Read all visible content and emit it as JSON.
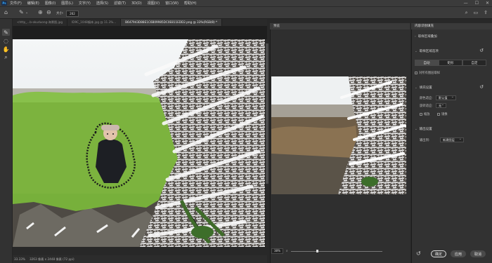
{
  "menubar": {
    "logo": "Ps",
    "items": [
      "文件(F)",
      "编辑(E)",
      "图像(I)",
      "图层(L)",
      "文字(Y)",
      "选择(S)",
      "滤镜(T)",
      "3D(D)",
      "视图(V)",
      "窗口(W)",
      "帮助(H)"
    ],
    "window_controls": [
      "—",
      "☐",
      "✕"
    ]
  },
  "options": {
    "size_label": "大小:",
    "size_value": "262"
  },
  "tabs": [
    "<http_...b-okuduong-海景图.jpg",
    "ID9C_1048编本.jpg @ 11.3%...",
    "B647943D88E1C6B09985DC0E811EDD2.png @ 33%(RGB/8) *"
  ],
  "status": {
    "zoom": "33.33%",
    "dims": "3263 像素 x 2448 像素 (72 ppi)"
  },
  "preview": {
    "header": "预览",
    "zoom": "38%"
  },
  "properties": {
    "header": "内容识别填充",
    "sampling_section": "取样区域叠加",
    "sampling_options_section": "取样区域选项",
    "seg_auto": "自动",
    "seg_rect": "矩形",
    "seg_custom": "自定",
    "sample_all_layers": "对所有图层取样",
    "fill_settings": "填充设置",
    "color_adapt_label": "颜色适应:",
    "color_adapt_value": "默认值",
    "rotate_adapt_label": "旋转适应:",
    "rotate_adapt_value": "无",
    "scale_label": "缩放",
    "mirror_label": "镜像",
    "output_settings": "输出设置",
    "output_to_label": "输出到:",
    "output_to_value": "新建图层",
    "ok": "确定",
    "apply": "应用",
    "cancel": "取消"
  },
  "colors": {
    "accent": "#31a8ff",
    "green_overlay": "#6fbf2a",
    "panel": "#323232"
  }
}
